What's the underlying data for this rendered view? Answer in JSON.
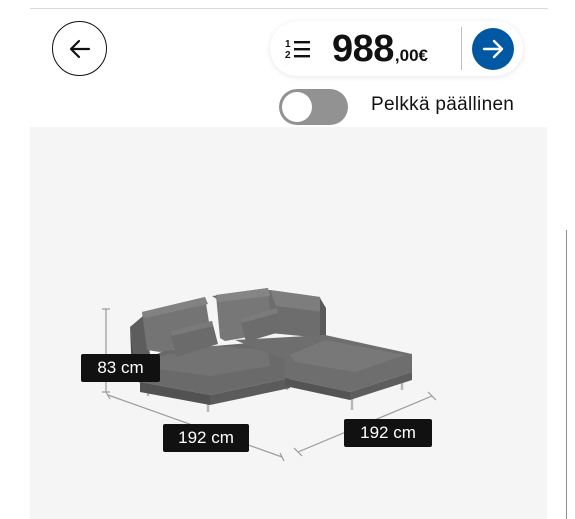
{
  "price": {
    "integer": "988",
    "decimal": ",00€"
  },
  "toggle": {
    "label": "Pelkkä päällinen",
    "state": "off"
  },
  "dimensions": {
    "height": "83 cm",
    "width": "192 cm",
    "depth": "192 cm"
  },
  "icons": {
    "back": "arrow-left-icon",
    "list": "numbered-list-icon",
    "next": "arrow-right-icon"
  },
  "colors": {
    "accent": "#0058a3",
    "toggle_off": "#929292"
  }
}
